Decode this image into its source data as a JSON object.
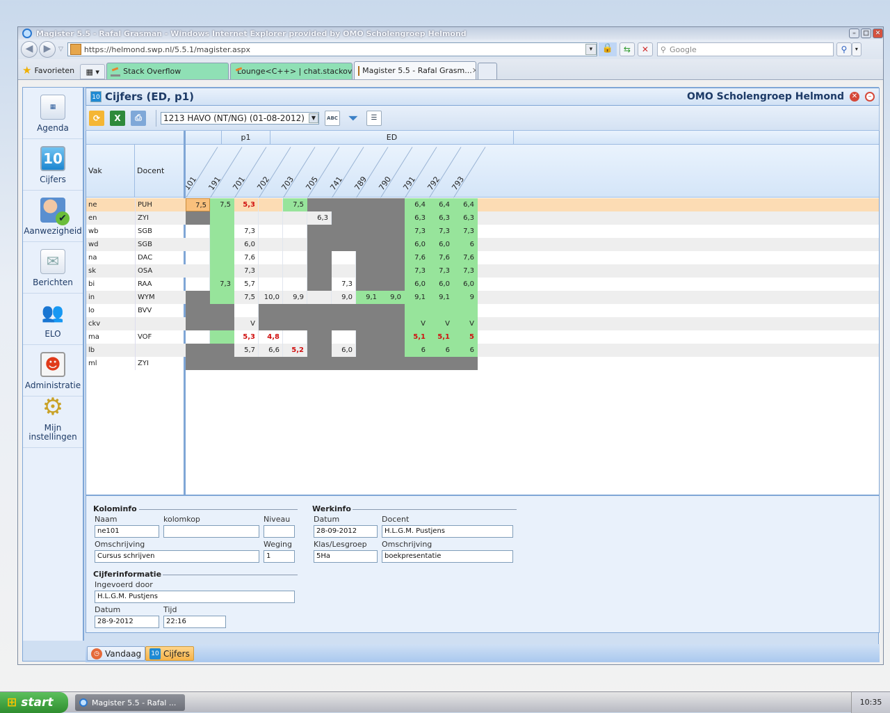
{
  "browser": {
    "window_title": "Magister 5.5 - Rafal Grasman - Windows Internet Explorer provided by OMO Scholengroep Helmond",
    "url": "https://helmond.swp.nl/5.5.1/magister.aspx",
    "search_placeholder": "Google",
    "favorites_label": "Favorieten",
    "tabs": [
      {
        "label": "Stack Overflow"
      },
      {
        "label": "Lounge<C++> | chat.stackove..."
      },
      {
        "label": "Magister 5.5 - Rafal Grasm..."
      }
    ]
  },
  "sidebar": {
    "items": [
      {
        "label": "Agenda",
        "icon": "calendar-icon"
      },
      {
        "label": "Cijfers",
        "icon": "grades-icon",
        "badge": "10"
      },
      {
        "label": "Aanwezigheid",
        "icon": "attendance-icon"
      },
      {
        "label": "Berichten",
        "icon": "mail-icon"
      },
      {
        "label": "ELO",
        "icon": "people-icon"
      },
      {
        "label": "Administratie",
        "icon": "admin-icon"
      },
      {
        "label": "Mijn instellingen",
        "icon": "gear-icon"
      }
    ]
  },
  "header": {
    "icon_badge": "10",
    "title": "Cijfers (ED, p1)",
    "organization": "OMO Scholengroep Helmond"
  },
  "toolbar": {
    "selected_period": "1213 HAVO (NT/NG) (01-08-2012)",
    "abc_label": "ABC"
  },
  "grid": {
    "group_headers": [
      {
        "label": ""
      },
      {
        "label": "p1"
      },
      {
        "label": "ED"
      }
    ],
    "col_vak": "Vak",
    "col_docent": "Docent",
    "columns": [
      "101",
      "191",
      "701",
      "702",
      "703",
      "705",
      "741",
      "789",
      "790",
      "791",
      "792",
      "793"
    ],
    "rows": [
      {
        "vak": "ne",
        "docent": "PUH",
        "cells": [
          [
            "7,5",
            "s"
          ],
          [
            "7,5",
            "g"
          ],
          [
            "5,3",
            "r"
          ],
          [
            "",
            ""
          ],
          [
            "7,5",
            "g"
          ],
          [
            "",
            "x"
          ],
          [
            "",
            "x"
          ],
          [
            "",
            "x"
          ],
          [
            "",
            "x"
          ],
          [
            "6,4",
            "g"
          ],
          [
            "6,4",
            "g"
          ],
          [
            "6,4",
            "g"
          ]
        ]
      },
      {
        "vak": "en",
        "docent": "ZYI",
        "cells": [
          [
            "",
            "x"
          ],
          [
            "",
            "g"
          ],
          [
            "",
            ""
          ],
          [
            "",
            ""
          ],
          [
            "",
            ""
          ],
          [
            "6,3",
            ""
          ],
          [
            "",
            "x"
          ],
          [
            "",
            "x"
          ],
          [
            "",
            "x"
          ],
          [
            "6,3",
            "g"
          ],
          [
            "6,3",
            "g"
          ],
          [
            "6,3",
            "g"
          ]
        ]
      },
      {
        "vak": "wb",
        "docent": "SGB",
        "cells": [
          [
            "",
            ""
          ],
          [
            "",
            "g"
          ],
          [
            "7,3",
            ""
          ],
          [
            "",
            ""
          ],
          [
            "",
            ""
          ],
          [
            "",
            "x"
          ],
          [
            "",
            "x"
          ],
          [
            "",
            "x"
          ],
          [
            "",
            "x"
          ],
          [
            "7,3",
            "g"
          ],
          [
            "7,3",
            "g"
          ],
          [
            "7,3",
            "g"
          ]
        ]
      },
      {
        "vak": "wd",
        "docent": "SGB",
        "cells": [
          [
            "",
            ""
          ],
          [
            "",
            "g"
          ],
          [
            "6,0",
            ""
          ],
          [
            "",
            ""
          ],
          [
            "",
            ""
          ],
          [
            "",
            "x"
          ],
          [
            "",
            "x"
          ],
          [
            "",
            "x"
          ],
          [
            "",
            "x"
          ],
          [
            "6,0",
            "g"
          ],
          [
            "6,0",
            "g"
          ],
          [
            "6",
            "g"
          ]
        ]
      },
      {
        "vak": "na",
        "docent": "DAC",
        "cells": [
          [
            "",
            ""
          ],
          [
            "",
            "g"
          ],
          [
            "7,6",
            ""
          ],
          [
            "",
            ""
          ],
          [
            "",
            ""
          ],
          [
            "",
            "x"
          ],
          [
            "",
            "w"
          ],
          [
            "",
            "x"
          ],
          [
            "",
            "x"
          ],
          [
            "7,6",
            "g"
          ],
          [
            "7,6",
            "g"
          ],
          [
            "7,6",
            "g"
          ]
        ]
      },
      {
        "vak": "sk",
        "docent": "OSA",
        "cells": [
          [
            "",
            ""
          ],
          [
            "",
            "g"
          ],
          [
            "7,3",
            ""
          ],
          [
            "",
            ""
          ],
          [
            "",
            ""
          ],
          [
            "",
            "x"
          ],
          [
            "",
            ""
          ],
          [
            "",
            "x"
          ],
          [
            "",
            "x"
          ],
          [
            "7,3",
            "g"
          ],
          [
            "7,3",
            "g"
          ],
          [
            "7,3",
            "g"
          ]
        ]
      },
      {
        "vak": "bi",
        "docent": "RAA",
        "cells": [
          [
            "",
            ""
          ],
          [
            "7,3",
            "g"
          ],
          [
            "5,7",
            ""
          ],
          [
            "",
            ""
          ],
          [
            "",
            ""
          ],
          [
            "",
            "x"
          ],
          [
            "7,3",
            ""
          ],
          [
            "",
            "x"
          ],
          [
            "",
            "x"
          ],
          [
            "6,0",
            "g"
          ],
          [
            "6,0",
            "g"
          ],
          [
            "6,0",
            "g"
          ]
        ]
      },
      {
        "vak": "in",
        "docent": "WYM",
        "cells": [
          [
            "",
            "x"
          ],
          [
            "",
            "g"
          ],
          [
            "7,5",
            ""
          ],
          [
            "10,0",
            ""
          ],
          [
            "9,9",
            ""
          ],
          [
            "",
            ""
          ],
          [
            "9,0",
            ""
          ],
          [
            "9,1",
            "g"
          ],
          [
            "9,0",
            "g"
          ],
          [
            "9,1",
            "g"
          ],
          [
            "9,1",
            "g"
          ],
          [
            "9",
            "g"
          ]
        ]
      },
      {
        "vak": "lo",
        "docent": "BVV",
        "cells": [
          [
            "",
            "x"
          ],
          [
            "",
            "x"
          ],
          [
            "",
            "w"
          ],
          [
            "",
            "x"
          ],
          [
            "",
            "x"
          ],
          [
            "",
            "x"
          ],
          [
            "",
            "x"
          ],
          [
            "",
            "x"
          ],
          [
            "",
            "x"
          ],
          [
            "",
            "g"
          ],
          [
            "",
            "g"
          ],
          [
            "",
            "g"
          ]
        ]
      },
      {
        "vak": "ckv",
        "docent": "",
        "cells": [
          [
            "",
            "x"
          ],
          [
            "",
            "x"
          ],
          [
            "V",
            ""
          ],
          [
            "",
            "x"
          ],
          [
            "",
            "x"
          ],
          [
            "",
            "x"
          ],
          [
            "",
            "x"
          ],
          [
            "",
            "x"
          ],
          [
            "",
            "x"
          ],
          [
            "V",
            "g"
          ],
          [
            "V",
            "g"
          ],
          [
            "V",
            "g"
          ]
        ]
      },
      {
        "vak": "ma",
        "docent": "VOF",
        "cells": [
          [
            "",
            ""
          ],
          [
            "",
            "g"
          ],
          [
            "5,3",
            "r"
          ],
          [
            "4,8",
            "r"
          ],
          [
            "",
            ""
          ],
          [
            "",
            "x"
          ],
          [
            "",
            ""
          ],
          [
            "",
            "x"
          ],
          [
            "",
            "x"
          ],
          [
            "5,1",
            "gr"
          ],
          [
            "5,1",
            "gr"
          ],
          [
            "5",
            "gr"
          ]
        ]
      },
      {
        "vak": "lb",
        "docent": "",
        "cells": [
          [
            "",
            "x"
          ],
          [
            "",
            "x"
          ],
          [
            "5,7",
            ""
          ],
          [
            "6,6",
            ""
          ],
          [
            "5,2",
            "r"
          ],
          [
            "",
            "x"
          ],
          [
            "6,0",
            ""
          ],
          [
            "",
            "x"
          ],
          [
            "",
            "x"
          ],
          [
            "6",
            "g"
          ],
          [
            "6",
            "g"
          ],
          [
            "6",
            "g"
          ]
        ]
      },
      {
        "vak": "ml",
        "docent": "ZYI",
        "cells": [
          [
            "",
            "x"
          ],
          [
            "",
            "x"
          ],
          [
            "",
            "x"
          ],
          [
            "",
            "x"
          ],
          [
            "",
            "x"
          ],
          [
            "",
            "x"
          ],
          [
            "",
            "x"
          ],
          [
            "",
            "x"
          ],
          [
            "",
            "x"
          ],
          [
            "",
            "x"
          ],
          [
            "",
            "x"
          ],
          [
            "",
            "x"
          ]
        ]
      }
    ]
  },
  "kolominfo": {
    "title": "Kolominfo",
    "naam_label": "Naam",
    "naam": "ne101",
    "kolomkop_label": "kolomkop",
    "kolomkop": "",
    "niveau_label": "Niveau",
    "niveau": "",
    "omschrijving_label": "Omschrijving",
    "omschrijving": "Cursus schrijven",
    "weging_label": "Weging",
    "weging": "1"
  },
  "werkinfo": {
    "title": "Werkinfo",
    "datum_label": "Datum",
    "datum": "28-09-2012",
    "docent_label": "Docent",
    "docent": "H.L.G.M. Pustjens",
    "klas_label": "Klas/Lesgroep",
    "klas": "5Ha",
    "omschrijving_label": "Omschrijving",
    "omschrijving": "boekpresentatie"
  },
  "cijferinformatie": {
    "title": "Cijferinformatie",
    "ingevoerd_label": "Ingevoerd door",
    "ingevoerd": "H.L.G.M. Pustjens",
    "datum_label": "Datum",
    "datum": "28-9-2012",
    "tijd_label": "Tijd",
    "tijd": "22:16"
  },
  "bottom_tabs": [
    {
      "label": "Vandaag"
    },
    {
      "label": "Cijfers",
      "badge": "10"
    }
  ],
  "taskbar": {
    "start_label": "start",
    "task_label": "Magister 5.5 - Rafal ...",
    "clock": "10:35"
  },
  "colors": {
    "green": "#97e49b",
    "gray": "#808080",
    "selected": "#f9c07c",
    "highlight_row": "#fcdcb4",
    "fail_red": "#d01010"
  }
}
